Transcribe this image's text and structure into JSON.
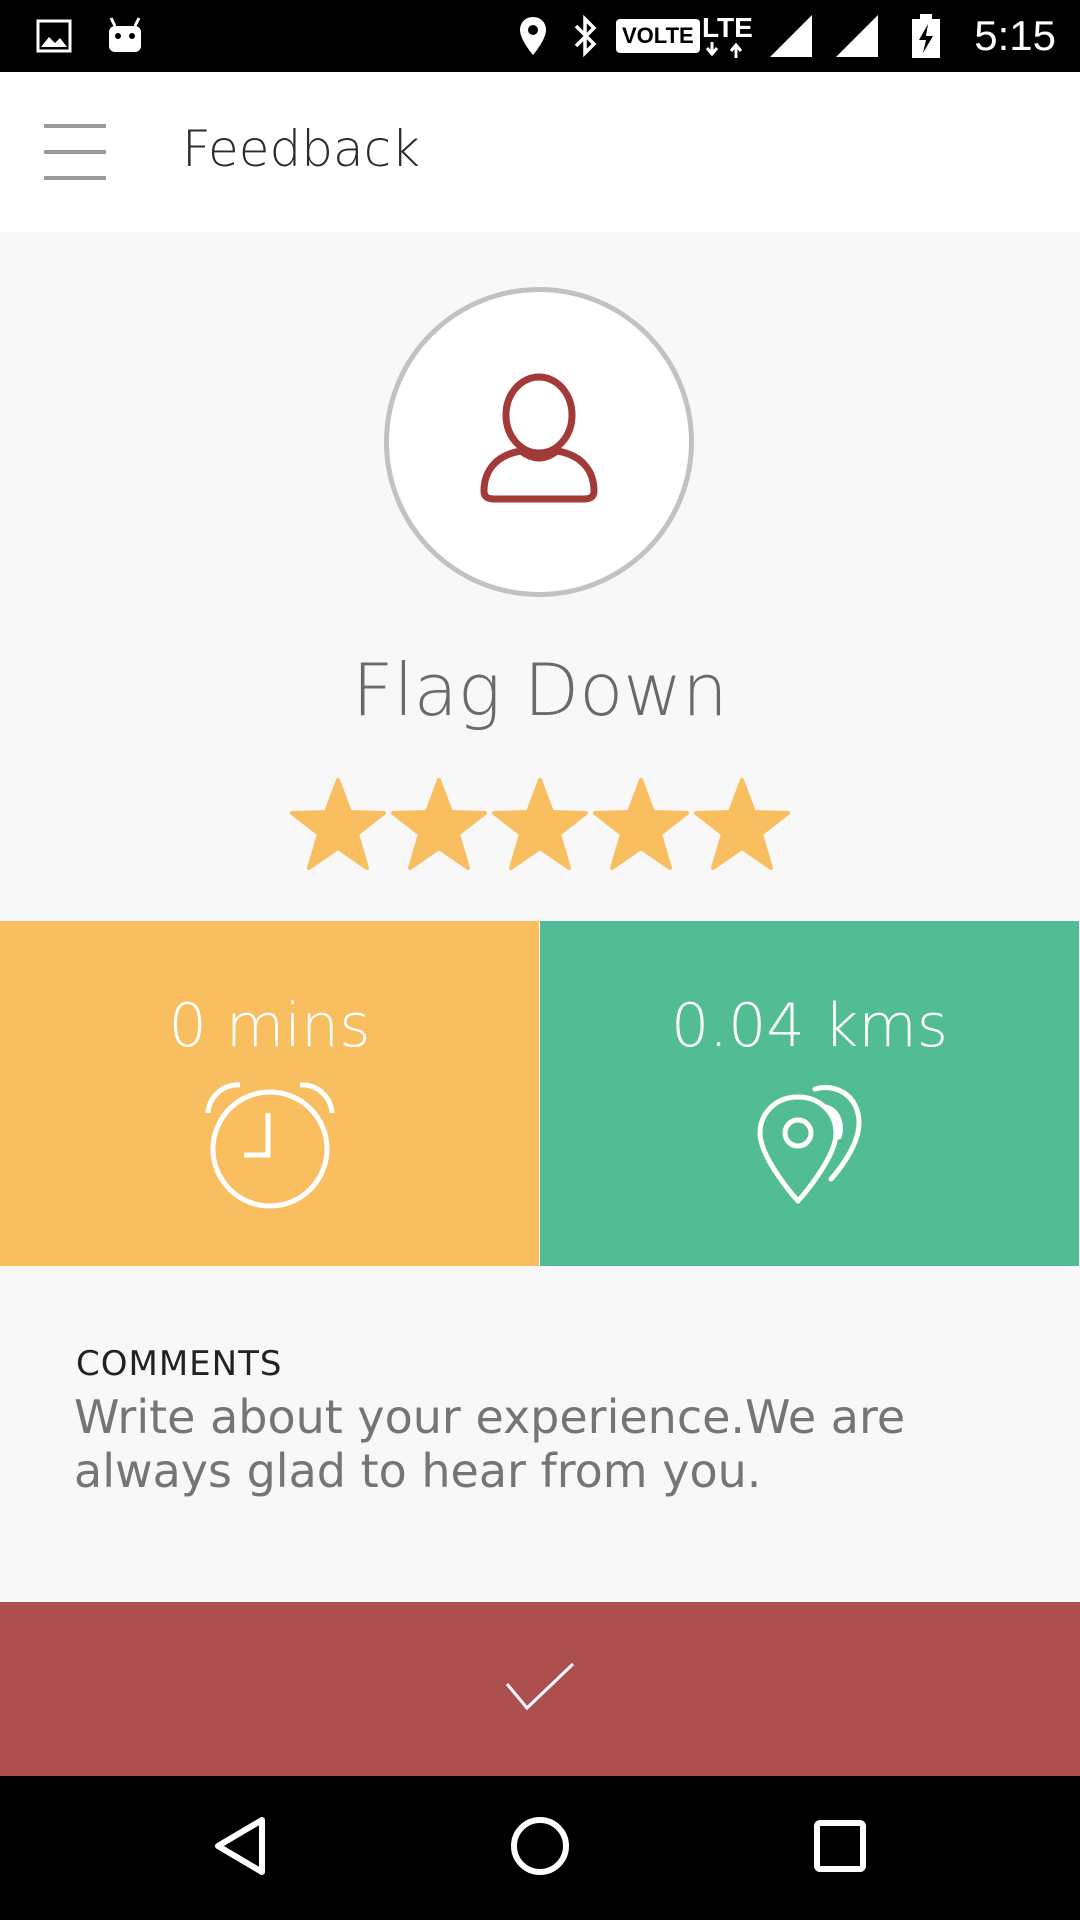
{
  "status_bar": {
    "time": "5:15",
    "network_badge": "VOLTE",
    "network_type": "LTE",
    "icons": [
      "gallery-icon",
      "android-icon",
      "location-icon",
      "bluetooth-icon",
      "volte-icon",
      "lte-icon",
      "signal-icon",
      "signal-icon",
      "battery-charging-icon"
    ]
  },
  "app_bar": {
    "title": "Feedback",
    "menu_icon": "menu-icon"
  },
  "driver": {
    "name": "Flag Down",
    "avatar_icon": "person-icon",
    "rating": 5,
    "rating_max": 5
  },
  "stats": {
    "time": {
      "value": "0 mins",
      "icon": "alarm-clock-icon"
    },
    "distance": {
      "value": "0.04 kms",
      "icon": "location-pins-icon"
    }
  },
  "comments": {
    "label": "COMMENTS",
    "placeholder": "Write about your experience.We are always glad to hear from you.",
    "value": ""
  },
  "submit": {
    "icon": "checkmark-icon"
  },
  "colors": {
    "accent": "#ae4f4f",
    "star": "#f8be5f",
    "time_tile": "#f8be5f",
    "distance_tile": "#52bd95",
    "avatar_icon": "#a33a3a"
  }
}
